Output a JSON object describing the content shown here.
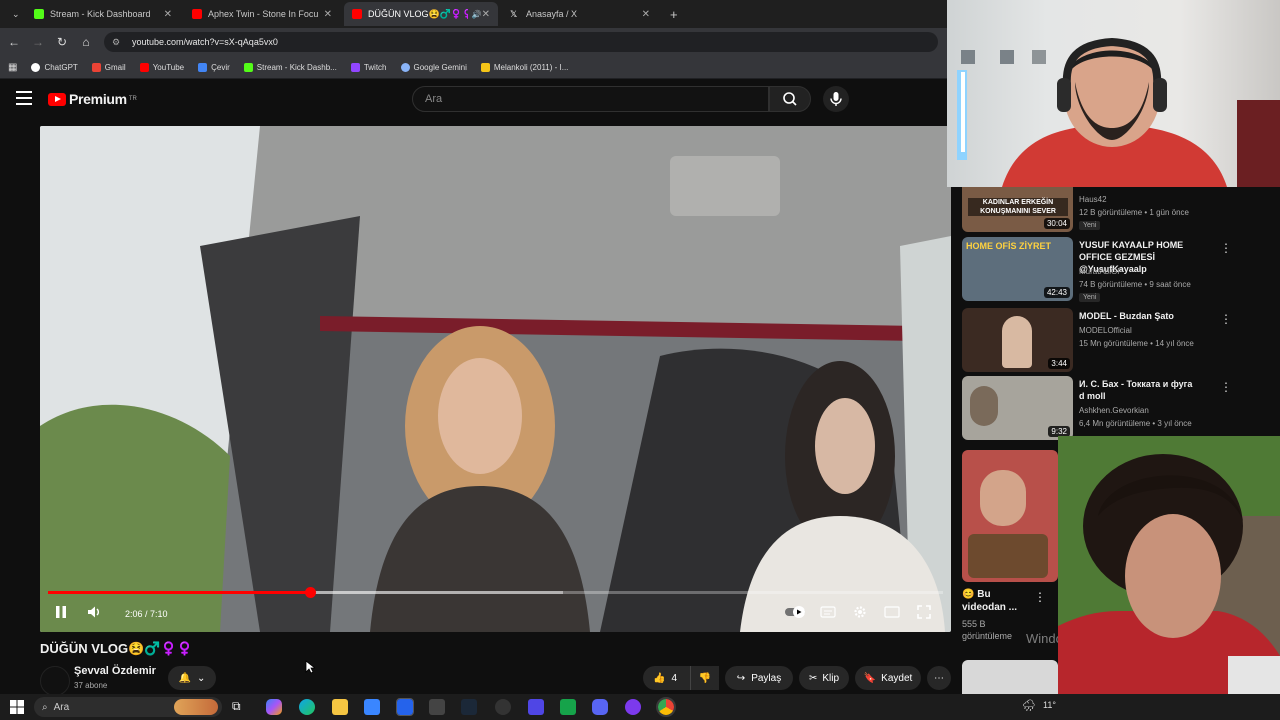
{
  "browser": {
    "tabs": [
      {
        "label": "Stream - Kick Dashboard",
        "color": "#53fc18"
      },
      {
        "label": "Aphex Twin - Stone In Focus - Y",
        "color": "#ff0000"
      },
      {
        "label": "DÜĞÜN VLOG😫♂️♀️♀️",
        "color": "#ff0000"
      },
      {
        "label": "Anasayfa / X",
        "color": "#ffffff"
      }
    ],
    "url": "youtube.com/watch?v=sX-qAqa5vx0",
    "bookmarks": [
      {
        "label": "ChatGPT",
        "color": "#ffffff"
      },
      {
        "label": "Gmail",
        "color": "#ea4335"
      },
      {
        "label": "YouTube",
        "color": "#ff0000"
      },
      {
        "label": "Çevir",
        "color": "#4285f4"
      },
      {
        "label": "Stream - Kick Dashb...",
        "color": "#53fc18"
      },
      {
        "label": "Twitch",
        "color": "#9146ff"
      },
      {
        "label": "Google Gemini",
        "color": "#8ab4f8"
      },
      {
        "label": "Melankoli (2011) - I...",
        "color": "#f5c518"
      }
    ]
  },
  "youtube": {
    "logo_text": "Premium",
    "logo_region": "TR",
    "search_placeholder": "Ara"
  },
  "player": {
    "time": "2:06 / 7:10",
    "progress": 0.293,
    "buffered": 0.575
  },
  "video": {
    "title": "DÜĞÜN VLOG😫♂️♀️♀️",
    "channel": "Şevval Özdemir",
    "subscribers": "37 abone",
    "likes": "4",
    "share_label": "Paylaş",
    "clip_label": "Klip",
    "save_label": "Kaydet"
  },
  "recommendations": [
    {
      "title": "",
      "channel": "Haus42",
      "meta": "12 B görüntüleme • 1 gün önce",
      "badge": "Yeni",
      "duration": "30:04",
      "thumb_text": "KADINLAR ERKEĞİN KONUŞMANINI SEVER",
      "color": "#7a5b45"
    },
    {
      "title": "YUSUF KAYAALP HOME OFFICE GEZMESİ @YusufKayaalp",
      "channel": "MuratAbiGF",
      "meta": "74 B görüntüleme • 9 saat önce",
      "badge": "Yeni",
      "duration": "42:43",
      "thumb_text": "HOME OFİS ZİYRET",
      "color": "#5d6e7c"
    },
    {
      "title": "MODEL - Buzdan Şato",
      "channel": "MODELOfficial",
      "meta": "15 Mn görüntüleme • 14 yıl önce",
      "badge": "",
      "duration": "3:44",
      "thumb_text": "",
      "color": "#3b2a22"
    },
    {
      "title": "И. С. Бах - Токката и фуга d moll",
      "channel": "Ashkhen.Gevorkian",
      "meta": "6,4 Mn görüntüleme • 3 yıl önce",
      "badge": "",
      "duration": "9:32",
      "thumb_text": "",
      "color": "#a7a49c"
    },
    {
      "title": "😊 Bu videodan ...",
      "channel": "",
      "meta": "555 B görüntüleme",
      "badge": "",
      "duration": "",
      "thumb_text": "",
      "color": "#b8504a"
    }
  ],
  "windows_watermark": "Windows",
  "taskbar": {
    "search_placeholder": "Ara",
    "temperature": "11°"
  }
}
